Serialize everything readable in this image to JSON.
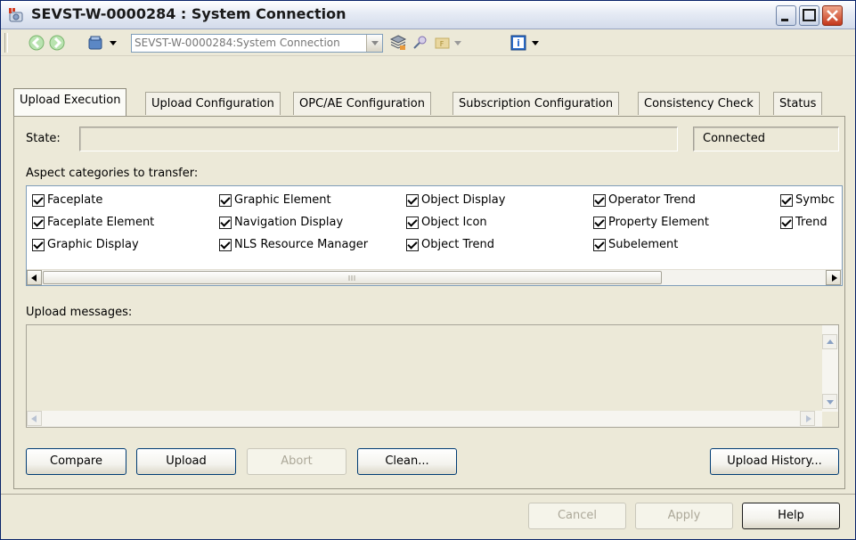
{
  "window": {
    "title": "SEVST-W-0000284 : System Connection"
  },
  "toolbar": {
    "combo_value": "SEVST-W-0000284:System Connection"
  },
  "tabs": [
    {
      "label": "Upload Execution"
    },
    {
      "label": "Upload Configuration"
    },
    {
      "label": "OPC/AE Configuration"
    },
    {
      "label": "Subscription Configuration"
    },
    {
      "label": "Consistency Check"
    },
    {
      "label": "Status"
    }
  ],
  "state": {
    "label": "State:",
    "value": "",
    "connection": "Connected"
  },
  "aspects": {
    "label": "Aspect categories to transfer:",
    "items": [
      {
        "label": "Faceplate",
        "checked": true
      },
      {
        "label": "Faceplate Element",
        "checked": true
      },
      {
        "label": "Graphic Display",
        "checked": true
      },
      {
        "label": "Graphic Element",
        "checked": true
      },
      {
        "label": "Navigation Display",
        "checked": true
      },
      {
        "label": "NLS Resource Manager",
        "checked": true
      },
      {
        "label": "Object Display",
        "checked": true
      },
      {
        "label": "Object Icon",
        "checked": true
      },
      {
        "label": "Object Trend",
        "checked": true
      },
      {
        "label": "Operator Trend",
        "checked": true
      },
      {
        "label": "Property Element",
        "checked": true
      },
      {
        "label": "Subelement",
        "checked": true
      },
      {
        "label": "Symbc",
        "checked": true
      },
      {
        "label": "Trend",
        "checked": true
      }
    ]
  },
  "messages": {
    "label": "Upload messages:"
  },
  "buttons": {
    "compare": "Compare",
    "upload": "Upload",
    "abort": "Abort",
    "clean": "Clean...",
    "history": "Upload History...",
    "cancel": "Cancel",
    "apply": "Apply",
    "help": "Help"
  },
  "colors": {
    "accent": "#0a246a",
    "close": "#c4371b"
  }
}
